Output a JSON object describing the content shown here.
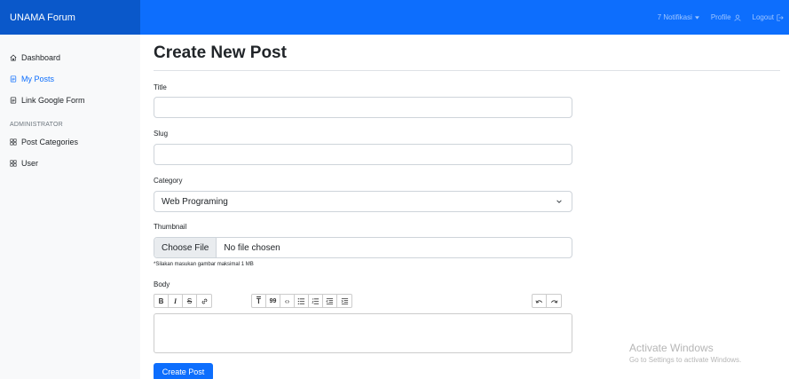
{
  "header": {
    "brand": "UNAMA Forum",
    "notifications_label": "7 Notifikasi",
    "profile_label": "Profile",
    "logout_label": "Logout"
  },
  "sidebar": {
    "items": [
      {
        "label": "Dashboard",
        "icon": "home-icon",
        "active": false
      },
      {
        "label": "My Posts",
        "icon": "document-icon",
        "active": true
      },
      {
        "label": "Link Google Form",
        "icon": "document-icon",
        "active": false
      }
    ],
    "admin_heading": "ADMINISTRATOR",
    "admin_items": [
      {
        "label": "Post Categories",
        "icon": "grid-icon"
      },
      {
        "label": "User",
        "icon": "grid-icon"
      }
    ]
  },
  "main": {
    "title": "Create New Post",
    "fields": {
      "title_label": "Title",
      "title_value": "",
      "slug_label": "Slug",
      "slug_value": "",
      "category_label": "Category",
      "category_selected": "Web Programing",
      "thumbnail_label": "Thumbnail",
      "file_button": "Choose File",
      "file_status": "No file chosen",
      "file_help": "*Silakan masukan gambar maksimal 1 MB",
      "body_label": "Body"
    },
    "toolbar": {
      "bold": "B",
      "italic": "I",
      "strike": "S",
      "heading": "T",
      "quote": "99",
      "code": "‹›"
    },
    "submit_label": "Create Post"
  },
  "watermark": {
    "line1": "Activate Windows",
    "line2": "Go to Settings to activate Windows."
  },
  "colors": {
    "primary": "#0d6efd",
    "brand_bg": "#0a58ca",
    "sidebar_bg": "#f8f9fa"
  }
}
